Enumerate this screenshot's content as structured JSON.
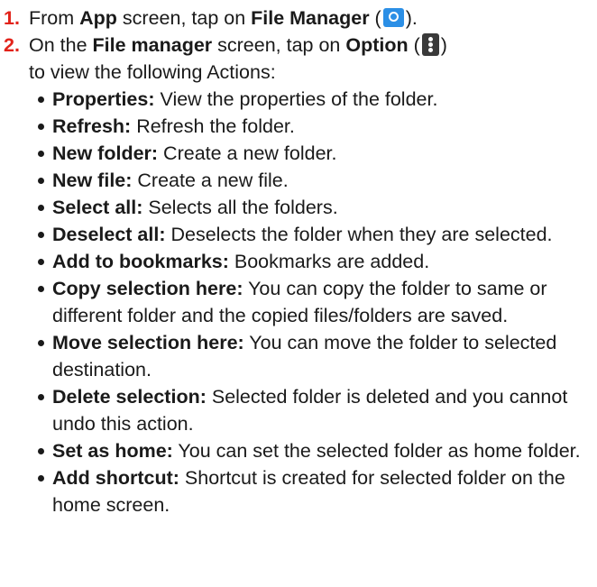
{
  "steps": [
    {
      "num": "1.",
      "t1": "From ",
      "b1": "App",
      "t2": " screen, tap on ",
      "b2": "File Manager",
      "t3": " (",
      "icon": "file-manager-icon",
      "t4": ")."
    },
    {
      "num": "2.",
      "t1": "On the ",
      "b1": "File manager",
      "t2": " screen, tap on ",
      "b2": "Option",
      "t3": " (",
      "icon": "options-menu-icon",
      "t4": ")",
      "t5": "to view the following Actions:"
    }
  ],
  "actions": [
    {
      "term": "Properties:",
      "desc": " View the properties of the folder."
    },
    {
      "term": "Refresh:",
      "desc": " Refresh the folder."
    },
    {
      "term": "New folder:",
      "desc": " Create a new folder."
    },
    {
      "term": "New file:",
      "desc": " Create a new file."
    },
    {
      "term": "Select all:",
      "desc": " Selects all the folders."
    },
    {
      "term": "Deselect all:",
      "desc": " Deselects the folder when they are selected."
    },
    {
      "term": "Add to bookmarks:",
      "desc": " Bookmarks are added."
    },
    {
      "term": "Copy selection here:",
      "desc": " You can copy the folder to same or different folder and the copied files/folders are saved."
    },
    {
      "term": "Move selection here:",
      "desc": " You can move the folder to selected destination."
    },
    {
      "term": "Delete selection:",
      "desc": " Selected folder is deleted and you cannot undo this action."
    },
    {
      "term": "Set as home:",
      "desc": " You can set the selected folder as home folder."
    },
    {
      "term": "Add shortcut:",
      "desc": " Shortcut is created for selected folder on the home screen."
    }
  ],
  "colors": {
    "step_number": "#e2231a",
    "file_manager_icon": "#2b8fe6",
    "options_icon": "#3a3a3a"
  }
}
